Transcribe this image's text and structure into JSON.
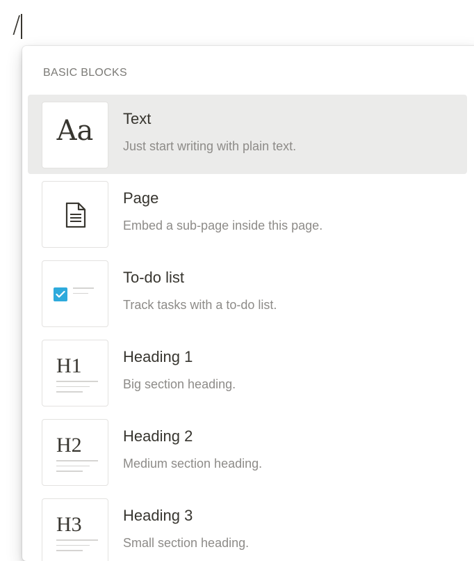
{
  "editor": {
    "typed_text": "/"
  },
  "menu": {
    "section_label": "BASIC BLOCKS",
    "items": [
      {
        "title": "Text",
        "description": "Just start writing with plain text.",
        "icon": "text-aa-icon",
        "selected": true,
        "preview_text": "Aa"
      },
      {
        "title": "Page",
        "description": "Embed a sub-page inside this page.",
        "icon": "page-document-icon",
        "selected": false
      },
      {
        "title": "To-do list",
        "description": "Track tasks with a to-do list.",
        "icon": "todo-checkbox-icon",
        "selected": false
      },
      {
        "title": "Heading 1",
        "description": "Big section heading.",
        "icon": "heading-1-icon",
        "selected": false,
        "preview_text": "H1"
      },
      {
        "title": "Heading 2",
        "description": "Medium section heading.",
        "icon": "heading-2-icon",
        "selected": false,
        "preview_text": "H2"
      },
      {
        "title": "Heading 3",
        "description": "Small section heading.",
        "icon": "heading-3-icon",
        "selected": false,
        "preview_text": "H3"
      }
    ]
  },
  "colors": {
    "text": "#37352f",
    "muted": "#8d8b88",
    "selected_bg": "#ebebea",
    "checkbox": "#2eaadc"
  }
}
